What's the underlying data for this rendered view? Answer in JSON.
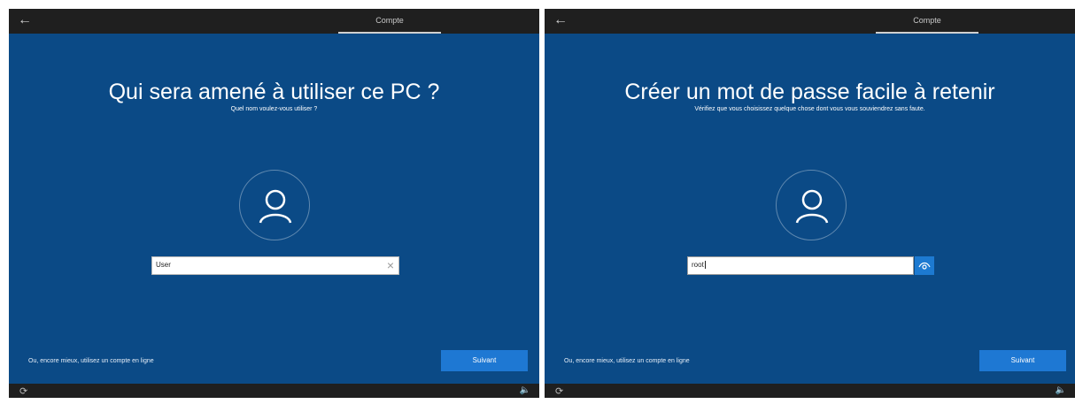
{
  "colors": {
    "main_bg": "#0b4a86",
    "chrome_bg": "#1f1f1f",
    "button_bg": "#1e78d3",
    "eye_bg": "#1d7ad1"
  },
  "screens": [
    {
      "tab": "Compte",
      "title": "Qui sera amené à utiliser ce PC ?",
      "subtitle": "Quel nom voulez-vous utiliser ?",
      "input_value": "User",
      "online_link": "Ou, encore mieux, utilisez un compte en ligne",
      "next_label": "Suivant"
    },
    {
      "tab": "Compte",
      "title": "Créer un mot de passe facile à retenir",
      "subtitle": "Vérifiez que vous choisissez quelque chose dont vous vous souviendrez sans faute.",
      "input_value": "root",
      "online_link": "Ou, encore mieux, utilisez un compte en ligne",
      "next_label": "Suivant"
    }
  ],
  "icons": {
    "back": "back-arrow-icon",
    "avatar": "person-icon",
    "clear": "clear-x-icon",
    "reveal": "eye-icon",
    "ease": "ease-of-access-icon",
    "volume": "volume-icon"
  }
}
